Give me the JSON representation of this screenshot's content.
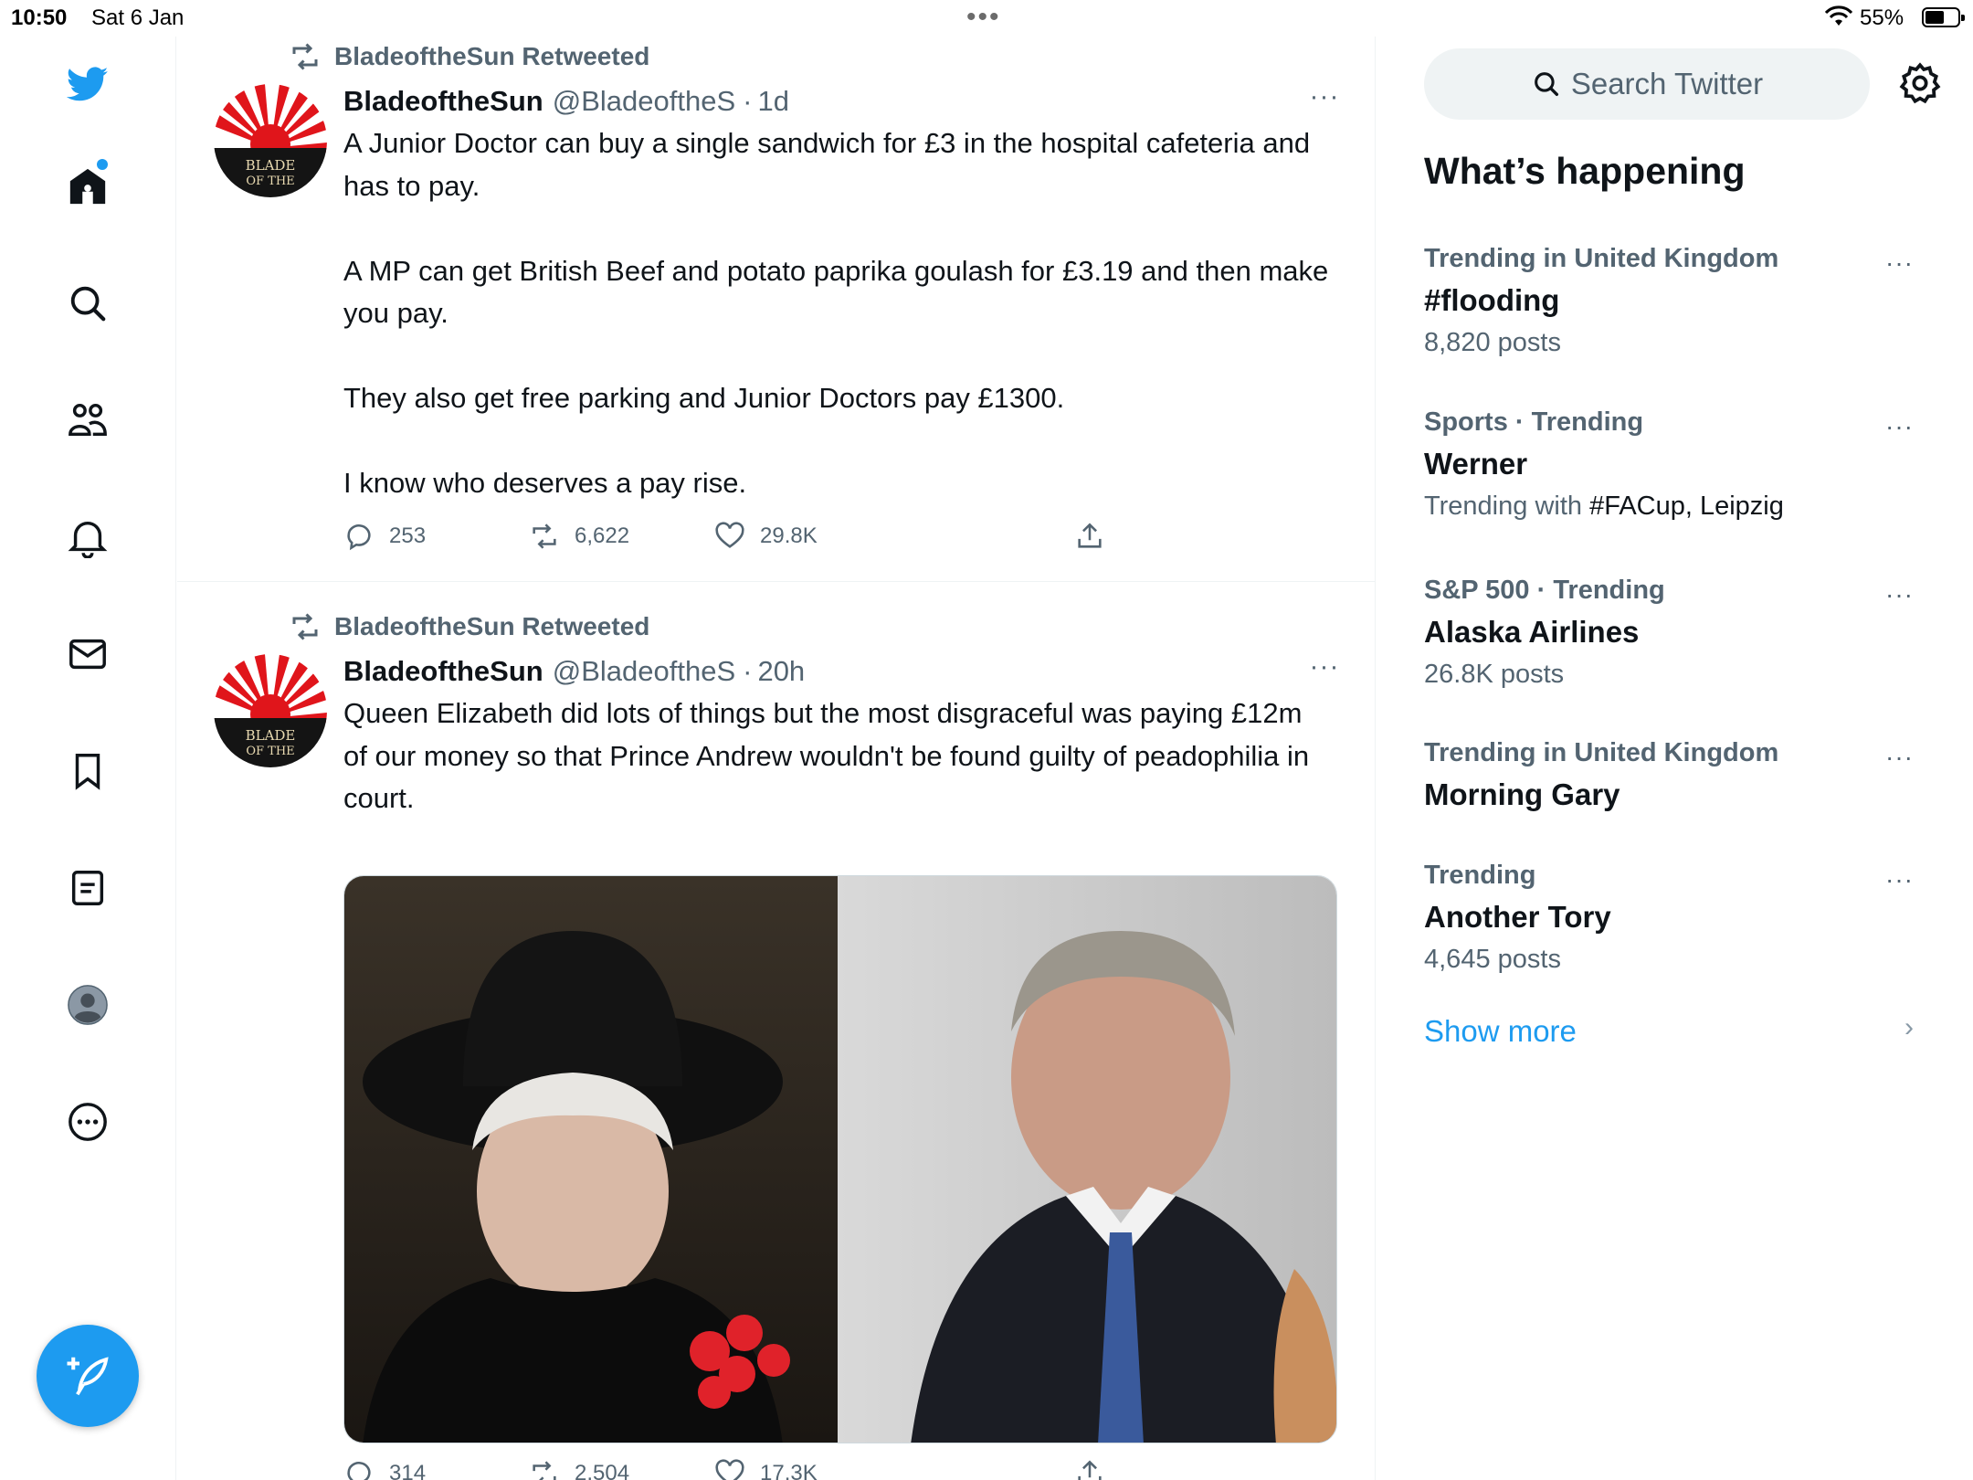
{
  "status_bar": {
    "time": "10:50",
    "date": "Sat 6 Jan",
    "battery": "55%"
  },
  "nav": {
    "items": [
      "twitter-logo",
      "home",
      "search",
      "communities",
      "notifications",
      "messages",
      "bookmarks",
      "lists",
      "profile",
      "more"
    ],
    "accent_color": "#1d9bf0"
  },
  "tweets": [
    {
      "retweeted_by": "BladeoftheSun Retweeted",
      "name": "BladeoftheSun",
      "handle": "@BladeoftheS",
      "separator": "·",
      "age": "1d",
      "paragraphs": [
        "A Junior Doctor can buy a single sandwich for £3 in the hospital cafeteria and has to pay.",
        "A MP can get British Beef and potato paprika goulash for £3.19 and then make you pay.",
        "They also get free parking and Junior Doctors pay £1300.",
        "I know who deserves a pay rise."
      ],
      "replies": "253",
      "retweets": "6,622",
      "likes": "29.8K"
    },
    {
      "retweeted_by": "BladeoftheSun Retweeted",
      "name": "BladeoftheSun",
      "handle": "@BladeoftheS",
      "separator": "·",
      "age": "20h",
      "paragraphs": [
        "Queen Elizabeth did lots of things but the most disgraceful was paying £12m of our money so that Prince Andrew wouldn't be found guilty of peadophilia in court."
      ],
      "replies": "314",
      "retweets": "2,504",
      "likes": "17.3K"
    }
  ],
  "sidebar": {
    "search_placeholder": "Search Twitter",
    "heading": "What’s happening",
    "trends": [
      {
        "meta": "Trending in United Kingdom",
        "title": "#flooding",
        "sub": "8,820 posts"
      },
      {
        "meta": "Sports · Trending",
        "title": "Werner",
        "sub_prefix": "Trending with ",
        "sub_tags": "#FACup, Leipzig"
      },
      {
        "meta": "S&P 500 · Trending",
        "title": "Alaska Airlines",
        "sub": "26.8K posts"
      },
      {
        "meta": "Trending in United Kingdom",
        "title": "Morning Gary"
      },
      {
        "meta": "Trending",
        "title": "Another Tory",
        "sub": "4,645 posts"
      }
    ],
    "show_more": "Show more"
  }
}
